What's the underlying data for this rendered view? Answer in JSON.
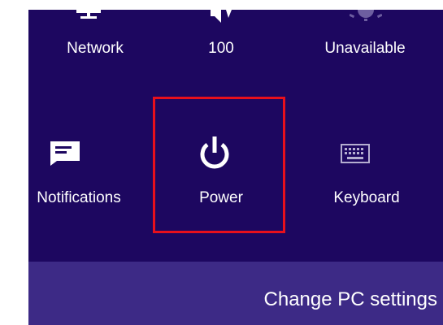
{
  "colors": {
    "panel_background": "#1d0760",
    "footer_background": "#3d2a86",
    "text": "#ffffff",
    "highlight_border": "#e8101c"
  },
  "tiles": [
    {
      "label": "Network",
      "icon": "network-icon"
    },
    {
      "label": "100",
      "icon": "volume-icon"
    },
    {
      "label": "Unavailable",
      "icon": "brightness-icon"
    },
    {
      "label": "Notifications",
      "icon": "notifications-icon"
    },
    {
      "label": "Power",
      "icon": "power-icon",
      "highlighted": true
    },
    {
      "label": "Keyboard",
      "icon": "keyboard-icon"
    }
  ],
  "footer": {
    "change_pc_settings": "Change PC settings"
  }
}
